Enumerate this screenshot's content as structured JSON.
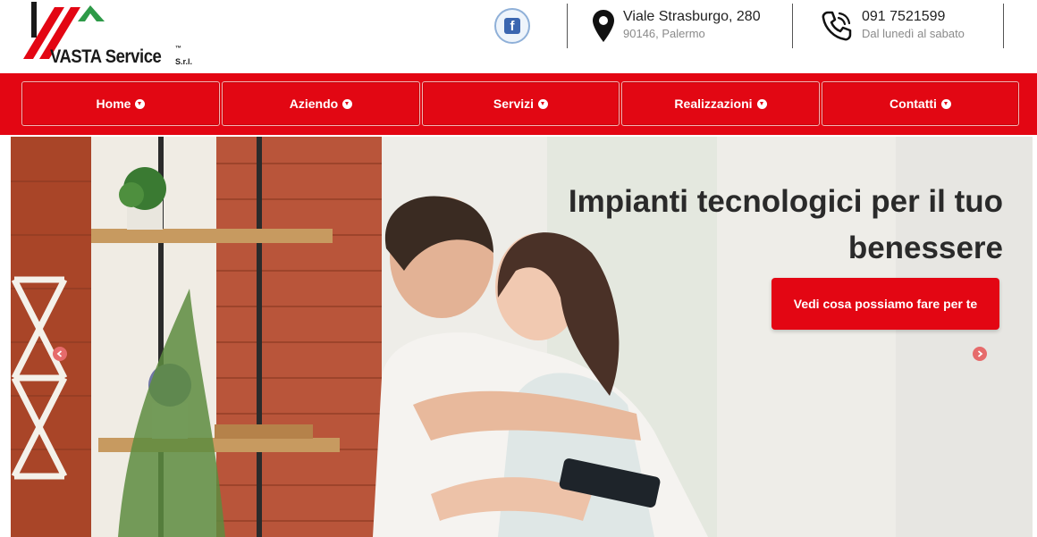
{
  "brand": {
    "name": "VASTA Service",
    "tm": "™",
    "suffix": "S.r.l.",
    "colors": {
      "red": "#e30613",
      "green": "#2e9a48",
      "dark": "#1a1a1a"
    }
  },
  "header": {
    "facebook_icon": "facebook-icon",
    "address": {
      "icon": "map-pin-icon",
      "line1": "Viale Strasburgo, 280",
      "line2": "90146, Palermo"
    },
    "phone": {
      "icon": "phone-icon",
      "line1": "091 7521599",
      "line2": "Dal lunedì al sabato"
    }
  },
  "nav": {
    "items": [
      {
        "label": "Home"
      },
      {
        "label": "Aziendo"
      },
      {
        "label": "Servizi"
      },
      {
        "label": "Realizzazioni"
      },
      {
        "label": "Contatti"
      }
    ],
    "accent": "#e30613"
  },
  "hero": {
    "title_line1": "Impianti tecnologici per il tuo",
    "title_line2": "benessere",
    "cta": "Vedi cosa possiamo fare per te",
    "prev_icon": "arrow-left-icon",
    "next_icon": "arrow-right-icon"
  }
}
